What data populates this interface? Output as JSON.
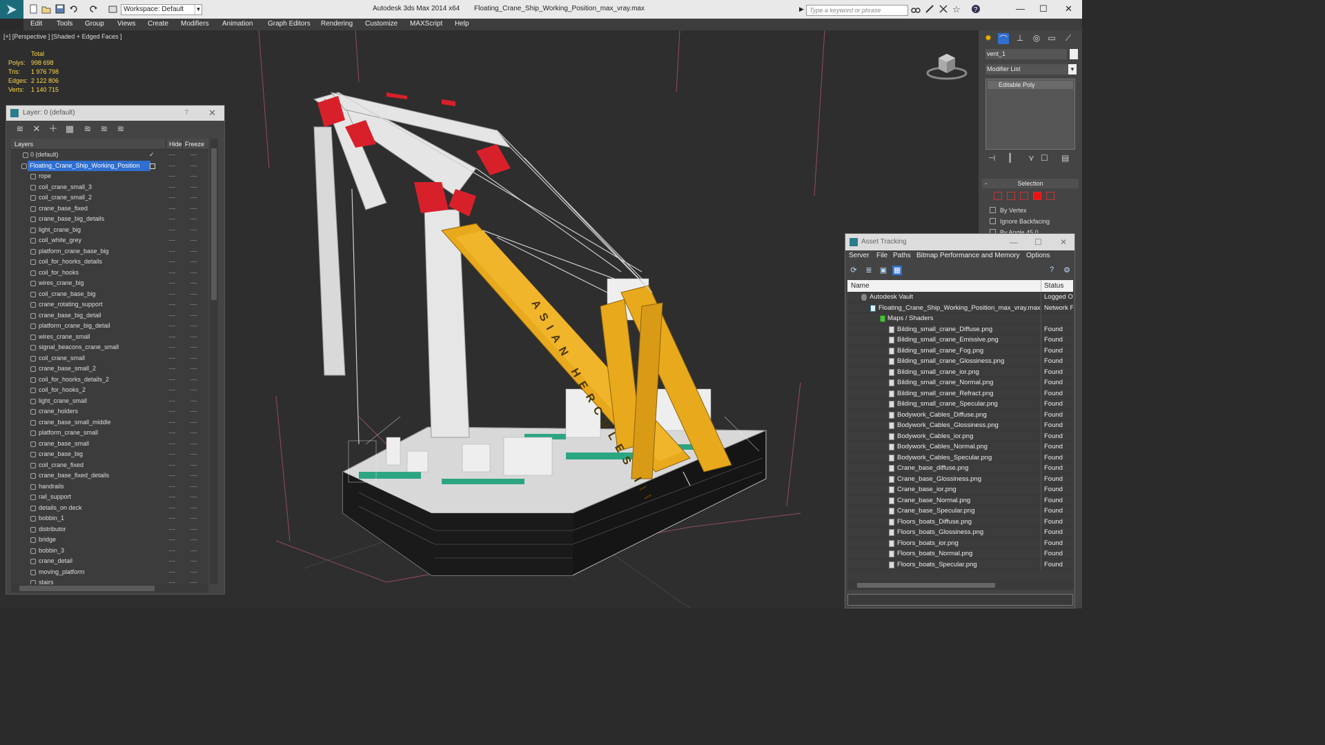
{
  "titlebar": {
    "workspace": "Workspace: Default",
    "app_name": "Autodesk 3ds Max  2014 x64",
    "file_name": "Floating_Crane_Ship_Working_Position_max_vray.max",
    "search_placeholder": "Type a keyword or phrase"
  },
  "menu": [
    "Edit",
    "Tools",
    "Group",
    "Views",
    "Create",
    "Modifiers",
    "Animation",
    "Graph Editors",
    "Rendering",
    "Customize",
    "MAXScript",
    "Help"
  ],
  "viewport": {
    "label": "[+] [Perspective ] [Shaded + Edged Faces ]",
    "stats_header": "Total",
    "stats": [
      {
        "k": "Polys:",
        "v": "998 698"
      },
      {
        "k": "Tris:",
        "v": "1 976 798"
      },
      {
        "k": "Edges:",
        "v": "2 122 806"
      },
      {
        "k": "Verts:",
        "v": "1 140 715"
      }
    ],
    "hull_text": "ASIAN HERCULES III"
  },
  "layer_panel": {
    "title": "Layer: 0 (default)",
    "help": "?",
    "col_layers": "Layers",
    "col_hide": "Hide",
    "col_freeze": "Freeze",
    "default_layer": "0 (default)",
    "selected_layer": "Floating_Crane_Ship_Working_Position",
    "objects": [
      "rope",
      "coil_crane_small_3",
      "coil_crane_small_2",
      "crane_base_fixed",
      "crane_base_big_details",
      "light_crane_big",
      "coil_white_grey",
      "platform_crane_base_big",
      "coil_for_hoorks_details",
      "coil_for_hooks",
      "wires_crane_big",
      "coil_crane_base_big",
      "crane_rotating_support",
      "crane_base_big_detail",
      "platform_crane_big_detail",
      "wires_crane_small",
      "signal_beacons_crane_small",
      "coil_crane_small",
      "crane_base_small_2",
      "coil_for_hoorks_details_2",
      "coil_for_hooks_2",
      "light_crane_small",
      "crane_holders",
      "crane_base_small_middle",
      "platform_crane_small",
      "crane_base_small",
      "crane_base_big",
      "coil_crane_fixed",
      "crane_base_fixed_details",
      "handrails",
      "rail_support",
      "details_on deck",
      "bobbin_1",
      "distributor",
      "bridge",
      "bobbin_3",
      "crane_detail",
      "moving_platform",
      "stairs"
    ]
  },
  "command_panel": {
    "object_name": "vent_1",
    "modifier_list": "Modifier List",
    "stack_item": "Editable Poly",
    "rollout_title": "Selection",
    "by_vertex": "By Vertex",
    "ignore_backfacing": "Ignore Backfacing",
    "by_angle": "By Angle",
    "angle_value": "45.0"
  },
  "asset_tracking": {
    "title": "Asset Tracking",
    "menu": [
      "Server",
      "File",
      "Paths",
      "Bitmap Performance and Memory",
      "Options"
    ],
    "col_name": "Name",
    "col_status": "Status",
    "vault": {
      "name": "Autodesk Vault",
      "status": "Logged O"
    },
    "file": {
      "name": "Floating_Crane_Ship_Working_Position_max_vray.max",
      "status": "Network F"
    },
    "maps_folder": "Maps / Shaders",
    "maps": [
      "Bilding_small_crane_Diffuse.png",
      "Bilding_small_crane_Emissive.png",
      "Bilding_small_crane_Fog.png",
      "Bilding_small_crane_Glossiness.png",
      "Bilding_small_crane_ior.png",
      "Bilding_small_crane_Normal.png",
      "Bilding_small_crane_Refract.png",
      "Bilding_small_crane_Specular.png",
      "Bodywork_Cables_Diffuse.png",
      "Bodywork_Cables_Glossiness.png",
      "Bodywork_Cables_ior.png",
      "Bodywork_Cables_Normal.png",
      "Bodywork_Cables_Specular.png",
      "Crane_base_diffuse.png",
      "Crane_base_Glossiness.png",
      "Crane_base_ior.png",
      "Crane_base_Normal.png",
      "Crane_base_Specular.png",
      "Floors_boats_Diffuse.png",
      "Floors_boats_Glossiness.png",
      "Floors_boats_ior.png",
      "Floors_boats_Normal.png",
      "Floors_boats_Specular.png"
    ],
    "map_status": "Found"
  },
  "colors": {
    "crane_yellow": "#e8a91c",
    "crane_red": "#d8202a",
    "deck_green": "#1aa07a",
    "selection_blue": "#2f6fd0",
    "stats_yellow": "#ffd84a"
  }
}
